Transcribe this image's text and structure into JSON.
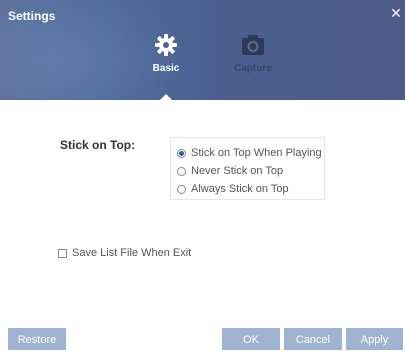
{
  "window": {
    "title": "Settings"
  },
  "tabs": [
    {
      "label": "Basic",
      "icon": "gear-icon",
      "active": true
    },
    {
      "label": "Capture",
      "icon": "camera-icon",
      "active": false
    }
  ],
  "stick_on_top": {
    "label": "Stick on Top:",
    "options": [
      {
        "label": "Stick on Top When Playing",
        "checked": true
      },
      {
        "label": "Never Stick on Top",
        "checked": false
      },
      {
        "label": "Always Stick on Top",
        "checked": false
      }
    ]
  },
  "save_list": {
    "label": "Save List File When Exit",
    "checked": false
  },
  "buttons": {
    "restore": "Restore",
    "ok": "OK",
    "cancel": "Cancel",
    "apply": "Apply"
  },
  "colors": {
    "header": "#4f6391",
    "button": "#9fb3d1",
    "radio_selected": "#2f5fa6"
  }
}
